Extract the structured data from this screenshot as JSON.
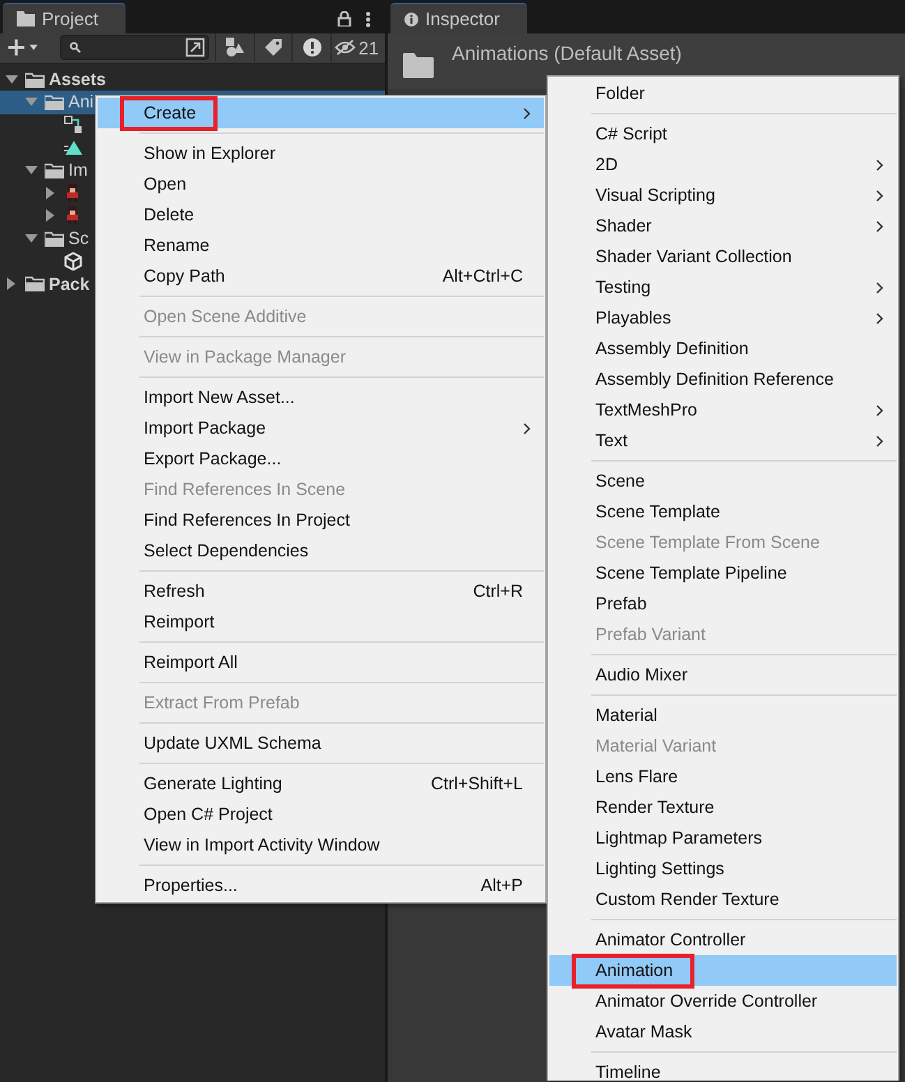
{
  "project": {
    "tab": "Project",
    "hidden_count": "21",
    "tree": [
      {
        "kind": "folder",
        "label": "Assets",
        "expanded": true,
        "selected": false,
        "children": [
          {
            "kind": "folder",
            "label": "Ani",
            "expanded": true,
            "selected": true,
            "children": [
              {
                "kind": "graph",
                "selected": false
              },
              {
                "kind": "clip",
                "selected": false
              }
            ]
          },
          {
            "kind": "folder",
            "label": "Im",
            "expanded": true,
            "selected": false,
            "children": [
              {
                "kind": "sprite",
                "expanded": false,
                "selected": false
              },
              {
                "kind": "sprite",
                "expanded": false,
                "selected": false
              }
            ]
          },
          {
            "kind": "folder",
            "label": "Sc",
            "expanded": true,
            "selected": false,
            "children": [
              {
                "kind": "scene",
                "selected": false
              }
            ]
          }
        ]
      },
      {
        "kind": "folder",
        "label": "Pack",
        "expanded": false,
        "selected": false
      }
    ]
  },
  "inspector": {
    "tab": "Inspector",
    "title": "Animations (Default Asset)"
  },
  "context_menu": [
    {
      "kind": "item",
      "label": "Create",
      "submenu": true,
      "disabled": false,
      "selected": true,
      "marked": true
    },
    {
      "kind": "separator"
    },
    {
      "kind": "item",
      "label": "Show in Explorer",
      "submenu": false,
      "disabled": false,
      "selected": false,
      "marked": false
    },
    {
      "kind": "item",
      "label": "Open",
      "submenu": false,
      "disabled": false,
      "selected": false,
      "marked": false
    },
    {
      "kind": "item",
      "label": "Delete",
      "submenu": false,
      "disabled": false,
      "selected": false,
      "marked": false
    },
    {
      "kind": "item",
      "label": "Rename",
      "submenu": false,
      "disabled": false,
      "selected": false,
      "marked": false
    },
    {
      "kind": "item",
      "label": "Copy Path",
      "shortcut": "Alt+Ctrl+C",
      "submenu": false,
      "disabled": false,
      "selected": false,
      "marked": false
    },
    {
      "kind": "separator"
    },
    {
      "kind": "item",
      "label": "Open Scene Additive",
      "submenu": false,
      "disabled": true,
      "selected": false,
      "marked": false
    },
    {
      "kind": "separator"
    },
    {
      "kind": "item",
      "label": "View in Package Manager",
      "submenu": false,
      "disabled": true,
      "selected": false,
      "marked": false
    },
    {
      "kind": "separator"
    },
    {
      "kind": "item",
      "label": "Import New Asset...",
      "submenu": false,
      "disabled": false,
      "selected": false,
      "marked": false
    },
    {
      "kind": "item",
      "label": "Import Package",
      "submenu": true,
      "disabled": false,
      "selected": false,
      "marked": false
    },
    {
      "kind": "item",
      "label": "Export Package...",
      "submenu": false,
      "disabled": false,
      "selected": false,
      "marked": false
    },
    {
      "kind": "item",
      "label": "Find References In Scene",
      "submenu": false,
      "disabled": true,
      "selected": false,
      "marked": false
    },
    {
      "kind": "item",
      "label": "Find References In Project",
      "submenu": false,
      "disabled": false,
      "selected": false,
      "marked": false
    },
    {
      "kind": "item",
      "label": "Select Dependencies",
      "submenu": false,
      "disabled": false,
      "selected": false,
      "marked": false
    },
    {
      "kind": "separator"
    },
    {
      "kind": "item",
      "label": "Refresh",
      "shortcut": "Ctrl+R",
      "submenu": false,
      "disabled": false,
      "selected": false,
      "marked": false
    },
    {
      "kind": "item",
      "label": "Reimport",
      "submenu": false,
      "disabled": false,
      "selected": false,
      "marked": false
    },
    {
      "kind": "separator"
    },
    {
      "kind": "item",
      "label": "Reimport All",
      "submenu": false,
      "disabled": false,
      "selected": false,
      "marked": false
    },
    {
      "kind": "separator"
    },
    {
      "kind": "item",
      "label": "Extract From Prefab",
      "submenu": false,
      "disabled": true,
      "selected": false,
      "marked": false
    },
    {
      "kind": "separator"
    },
    {
      "kind": "item",
      "label": "Update UXML Schema",
      "submenu": false,
      "disabled": false,
      "selected": false,
      "marked": false
    },
    {
      "kind": "separator"
    },
    {
      "kind": "item",
      "label": "Generate Lighting",
      "shortcut": "Ctrl+Shift+L",
      "submenu": false,
      "disabled": false,
      "selected": false,
      "marked": false
    },
    {
      "kind": "item",
      "label": "Open C# Project",
      "submenu": false,
      "disabled": false,
      "selected": false,
      "marked": false
    },
    {
      "kind": "item",
      "label": "View in Import Activity Window",
      "submenu": false,
      "disabled": false,
      "selected": false,
      "marked": false
    },
    {
      "kind": "separator"
    },
    {
      "kind": "item",
      "label": "Properties...",
      "shortcut": "Alt+P",
      "submenu": false,
      "disabled": false,
      "selected": false,
      "marked": false
    }
  ],
  "create_submenu": [
    {
      "kind": "item",
      "label": "Folder",
      "submenu": false,
      "disabled": false,
      "selected": false,
      "marked": false
    },
    {
      "kind": "separator"
    },
    {
      "kind": "item",
      "label": "C# Script",
      "submenu": false,
      "disabled": false,
      "selected": false,
      "marked": false
    },
    {
      "kind": "item",
      "label": "2D",
      "submenu": true,
      "disabled": false,
      "selected": false,
      "marked": false
    },
    {
      "kind": "item",
      "label": "Visual Scripting",
      "submenu": true,
      "disabled": false,
      "selected": false,
      "marked": false
    },
    {
      "kind": "item",
      "label": "Shader",
      "submenu": true,
      "disabled": false,
      "selected": false,
      "marked": false
    },
    {
      "kind": "item",
      "label": "Shader Variant Collection",
      "submenu": false,
      "disabled": false,
      "selected": false,
      "marked": false
    },
    {
      "kind": "item",
      "label": "Testing",
      "submenu": true,
      "disabled": false,
      "selected": false,
      "marked": false
    },
    {
      "kind": "item",
      "label": "Playables",
      "submenu": true,
      "disabled": false,
      "selected": false,
      "marked": false
    },
    {
      "kind": "item",
      "label": "Assembly Definition",
      "submenu": false,
      "disabled": false,
      "selected": false,
      "marked": false
    },
    {
      "kind": "item",
      "label": "Assembly Definition Reference",
      "submenu": false,
      "disabled": false,
      "selected": false,
      "marked": false
    },
    {
      "kind": "item",
      "label": "TextMeshPro",
      "submenu": true,
      "disabled": false,
      "selected": false,
      "marked": false
    },
    {
      "kind": "item",
      "label": "Text",
      "submenu": true,
      "disabled": false,
      "selected": false,
      "marked": false
    },
    {
      "kind": "separator"
    },
    {
      "kind": "item",
      "label": "Scene",
      "submenu": false,
      "disabled": false,
      "selected": false,
      "marked": false
    },
    {
      "kind": "item",
      "label": "Scene Template",
      "submenu": false,
      "disabled": false,
      "selected": false,
      "marked": false
    },
    {
      "kind": "item",
      "label": "Scene Template From Scene",
      "submenu": false,
      "disabled": true,
      "selected": false,
      "marked": false
    },
    {
      "kind": "item",
      "label": "Scene Template Pipeline",
      "submenu": false,
      "disabled": false,
      "selected": false,
      "marked": false
    },
    {
      "kind": "item",
      "label": "Prefab",
      "submenu": false,
      "disabled": false,
      "selected": false,
      "marked": false
    },
    {
      "kind": "item",
      "label": "Prefab Variant",
      "submenu": false,
      "disabled": true,
      "selected": false,
      "marked": false
    },
    {
      "kind": "separator"
    },
    {
      "kind": "item",
      "label": "Audio Mixer",
      "submenu": false,
      "disabled": false,
      "selected": false,
      "marked": false
    },
    {
      "kind": "separator"
    },
    {
      "kind": "item",
      "label": "Material",
      "submenu": false,
      "disabled": false,
      "selected": false,
      "marked": false
    },
    {
      "kind": "item",
      "label": "Material Variant",
      "submenu": false,
      "disabled": true,
      "selected": false,
      "marked": false
    },
    {
      "kind": "item",
      "label": "Lens Flare",
      "submenu": false,
      "disabled": false,
      "selected": false,
      "marked": false
    },
    {
      "kind": "item",
      "label": "Render Texture",
      "submenu": false,
      "disabled": false,
      "selected": false,
      "marked": false
    },
    {
      "kind": "item",
      "label": "Lightmap Parameters",
      "submenu": false,
      "disabled": false,
      "selected": false,
      "marked": false
    },
    {
      "kind": "item",
      "label": "Lighting Settings",
      "submenu": false,
      "disabled": false,
      "selected": false,
      "marked": false
    },
    {
      "kind": "item",
      "label": "Custom Render Texture",
      "submenu": false,
      "disabled": false,
      "selected": false,
      "marked": false
    },
    {
      "kind": "separator"
    },
    {
      "kind": "item",
      "label": "Animator Controller",
      "submenu": false,
      "disabled": false,
      "selected": false,
      "marked": false
    },
    {
      "kind": "item",
      "label": "Animation",
      "submenu": false,
      "disabled": false,
      "selected": true,
      "marked": true
    },
    {
      "kind": "item",
      "label": "Animator Override Controller",
      "submenu": false,
      "disabled": false,
      "selected": false,
      "marked": false
    },
    {
      "kind": "item",
      "label": "Avatar Mask",
      "submenu": false,
      "disabled": false,
      "selected": false,
      "marked": false
    },
    {
      "kind": "separator"
    },
    {
      "kind": "item",
      "label": "Timeline",
      "submenu": false,
      "disabled": false,
      "selected": false,
      "marked": false
    }
  ]
}
